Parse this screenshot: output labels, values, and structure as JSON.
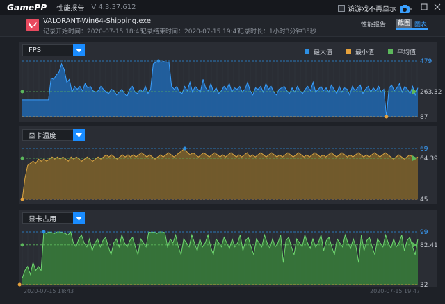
{
  "app": {
    "logo": "GamePP",
    "title": "性能报告",
    "version": "V 4.3.37.612",
    "hide_game_label": "该游戏不再显示"
  },
  "header": {
    "game_name": "VALORANT-Win64-Shipping.exe",
    "start_time": "记录开始时间：2020-07-15 18:43",
    "end_time": "记录结束时间：2020-07-15 19:47",
    "duration": "记录时长：1小时3分钟35秒",
    "tabs": [
      "性能报告",
      "截图",
      "图表"
    ],
    "active_tab": "图表"
  },
  "legend": {
    "max": "最大值",
    "min": "最小值",
    "avg": "平均值"
  },
  "colors": {
    "max": "#2d8fe3",
    "min": "#e6a23c",
    "avg": "#5cb85c",
    "accent": "#1a8cff",
    "fps_fill": "#1f6fbf",
    "fps_line": "#3aa0ff",
    "temp_fill": "#8a6a2a",
    "temp_line": "#d9a441",
    "usage_fill": "#3b8a3b",
    "usage_line": "#6fd86f"
  },
  "charts": [
    {
      "name": "FPS",
      "max_label": "479",
      "avg_label": "263.32",
      "min_label": "87"
    },
    {
      "name": "显卡温度",
      "max_label": "69",
      "avg_label": "64.39",
      "min_label": "45"
    },
    {
      "name": "显卡占用",
      "max_label": "99",
      "avg_label": "82.41",
      "min_label": "32"
    }
  ],
  "dates": {
    "start": "2020-07-15 18:43",
    "end": "2020-07-15 19:47"
  },
  "chart_data": [
    {
      "type": "area",
      "title": "FPS",
      "ylim": [
        87,
        479
      ],
      "max": 479,
      "min": 87,
      "avg": 263.32,
      "x": [
        "2020-07-15 18:43",
        "2020-07-15 19:47"
      ],
      "values": [
        205,
        205,
        205,
        205,
        205,
        205,
        205,
        205,
        205,
        205,
        205,
        360,
        350,
        380,
        400,
        460,
        420,
        330,
        350,
        260,
        300,
        280,
        300,
        270,
        320,
        290,
        300,
        270,
        260,
        270,
        300,
        280,
        260,
        250,
        280,
        270,
        240,
        260,
        280,
        250,
        230,
        280,
        300,
        260,
        250,
        280,
        260,
        300,
        250,
        280,
        460,
        470,
        479,
        470,
        476,
        470,
        472,
        300,
        280,
        300,
        260,
        250,
        300,
        270,
        330,
        260,
        300,
        280,
        260,
        350,
        290,
        270,
        320,
        260,
        290,
        250,
        270,
        300,
        280,
        320,
        260,
        290,
        280,
        300,
        260,
        280,
        330,
        270,
        240,
        290,
        280,
        300,
        260,
        320,
        280,
        300,
        260,
        240,
        280,
        290,
        300,
        270,
        250,
        290,
        260,
        300,
        270,
        250,
        280,
        300,
        270,
        330,
        260,
        280,
        300,
        270,
        290,
        260,
        310,
        280,
        250,
        300,
        260,
        290,
        280,
        240,
        300,
        270,
        290,
        310,
        250,
        280,
        300,
        260,
        290,
        270,
        300,
        260,
        280,
        87,
        290,
        310,
        270,
        290,
        320,
        260,
        300,
        280,
        250,
        300,
        240,
        290
      ]
    },
    {
      "type": "area",
      "title": "显卡温度",
      "ylim": [
        45,
        69
      ],
      "max": 69,
      "min": 45,
      "avg": 64.39,
      "x": [
        "2020-07-15 18:43",
        "2020-07-15 19:47"
      ],
      "values": [
        45,
        55,
        61,
        62,
        63,
        62,
        64,
        63,
        64,
        63,
        64,
        65,
        64,
        65,
        64,
        65,
        64,
        63,
        65,
        64,
        65,
        64,
        63,
        64,
        65,
        64,
        63,
        64,
        65,
        64,
        65,
        66,
        65,
        66,
        65,
        64,
        65,
        66,
        65,
        66,
        65,
        66,
        65,
        66,
        67,
        66,
        65,
        66,
        65,
        64,
        65,
        66,
        65,
        66,
        67,
        66,
        65,
        66,
        67,
        68,
        69,
        67,
        66,
        67,
        66,
        65,
        66,
        67,
        66,
        65,
        66,
        67,
        66,
        65,
        66,
        65,
        66,
        67,
        66,
        65,
        66,
        65,
        66,
        67,
        65,
        66,
        65,
        66,
        67,
        66,
        65,
        66,
        67,
        66,
        65,
        66,
        65,
        66,
        67,
        66,
        65,
        66,
        67,
        66,
        65,
        66,
        65,
        66,
        67,
        66,
        65,
        66,
        65,
        66,
        67,
        66,
        65,
        66,
        67,
        66,
        65,
        66,
        65,
        66,
        67,
        66,
        65,
        66,
        65,
        66,
        67,
        66,
        65,
        66,
        67,
        66,
        65,
        64,
        65,
        66,
        65,
        64,
        65,
        66,
        65,
        64,
        65
      ]
    },
    {
      "type": "area",
      "title": "显卡占用",
      "ylim": [
        32,
        99
      ],
      "max": 99,
      "min": 32,
      "avg": 82.41,
      "x": [
        "2020-07-15 18:43",
        "2020-07-15 19:47"
      ],
      "values": [
        40,
        50,
        55,
        45,
        60,
        50,
        55,
        50,
        99,
        97,
        99,
        98,
        97,
        99,
        99,
        98,
        97,
        95,
        99,
        85,
        80,
        90,
        95,
        85,
        80,
        90,
        75,
        85,
        90,
        80,
        88,
        92,
        80,
        70,
        85,
        90,
        80,
        95,
        85,
        80,
        88,
        92,
        80,
        70,
        90,
        85,
        80,
        99,
        98,
        99,
        97,
        99,
        99,
        98,
        80,
        90,
        85,
        95,
        80,
        70,
        90,
        85,
        80,
        95,
        85,
        75,
        90,
        80,
        85,
        95,
        80,
        70,
        90,
        85,
        80,
        92,
        85,
        78,
        90,
        80,
        85,
        95,
        75,
        88,
        92,
        80,
        70,
        90,
        85,
        80,
        95,
        85,
        78,
        90,
        80,
        85,
        95,
        60,
        88,
        92,
        80,
        70,
        90,
        85,
        80,
        95,
        85,
        78,
        90,
        80,
        85,
        95,
        75,
        88,
        92,
        80,
        70,
        90,
        85,
        80,
        95,
        85,
        78,
        90,
        80,
        60,
        95,
        75,
        88,
        92,
        80,
        70,
        90,
        85,
        80,
        95,
        85,
        78,
        90,
        80,
        85,
        95,
        75,
        88,
        92,
        80,
        70,
        90
      ]
    }
  ]
}
